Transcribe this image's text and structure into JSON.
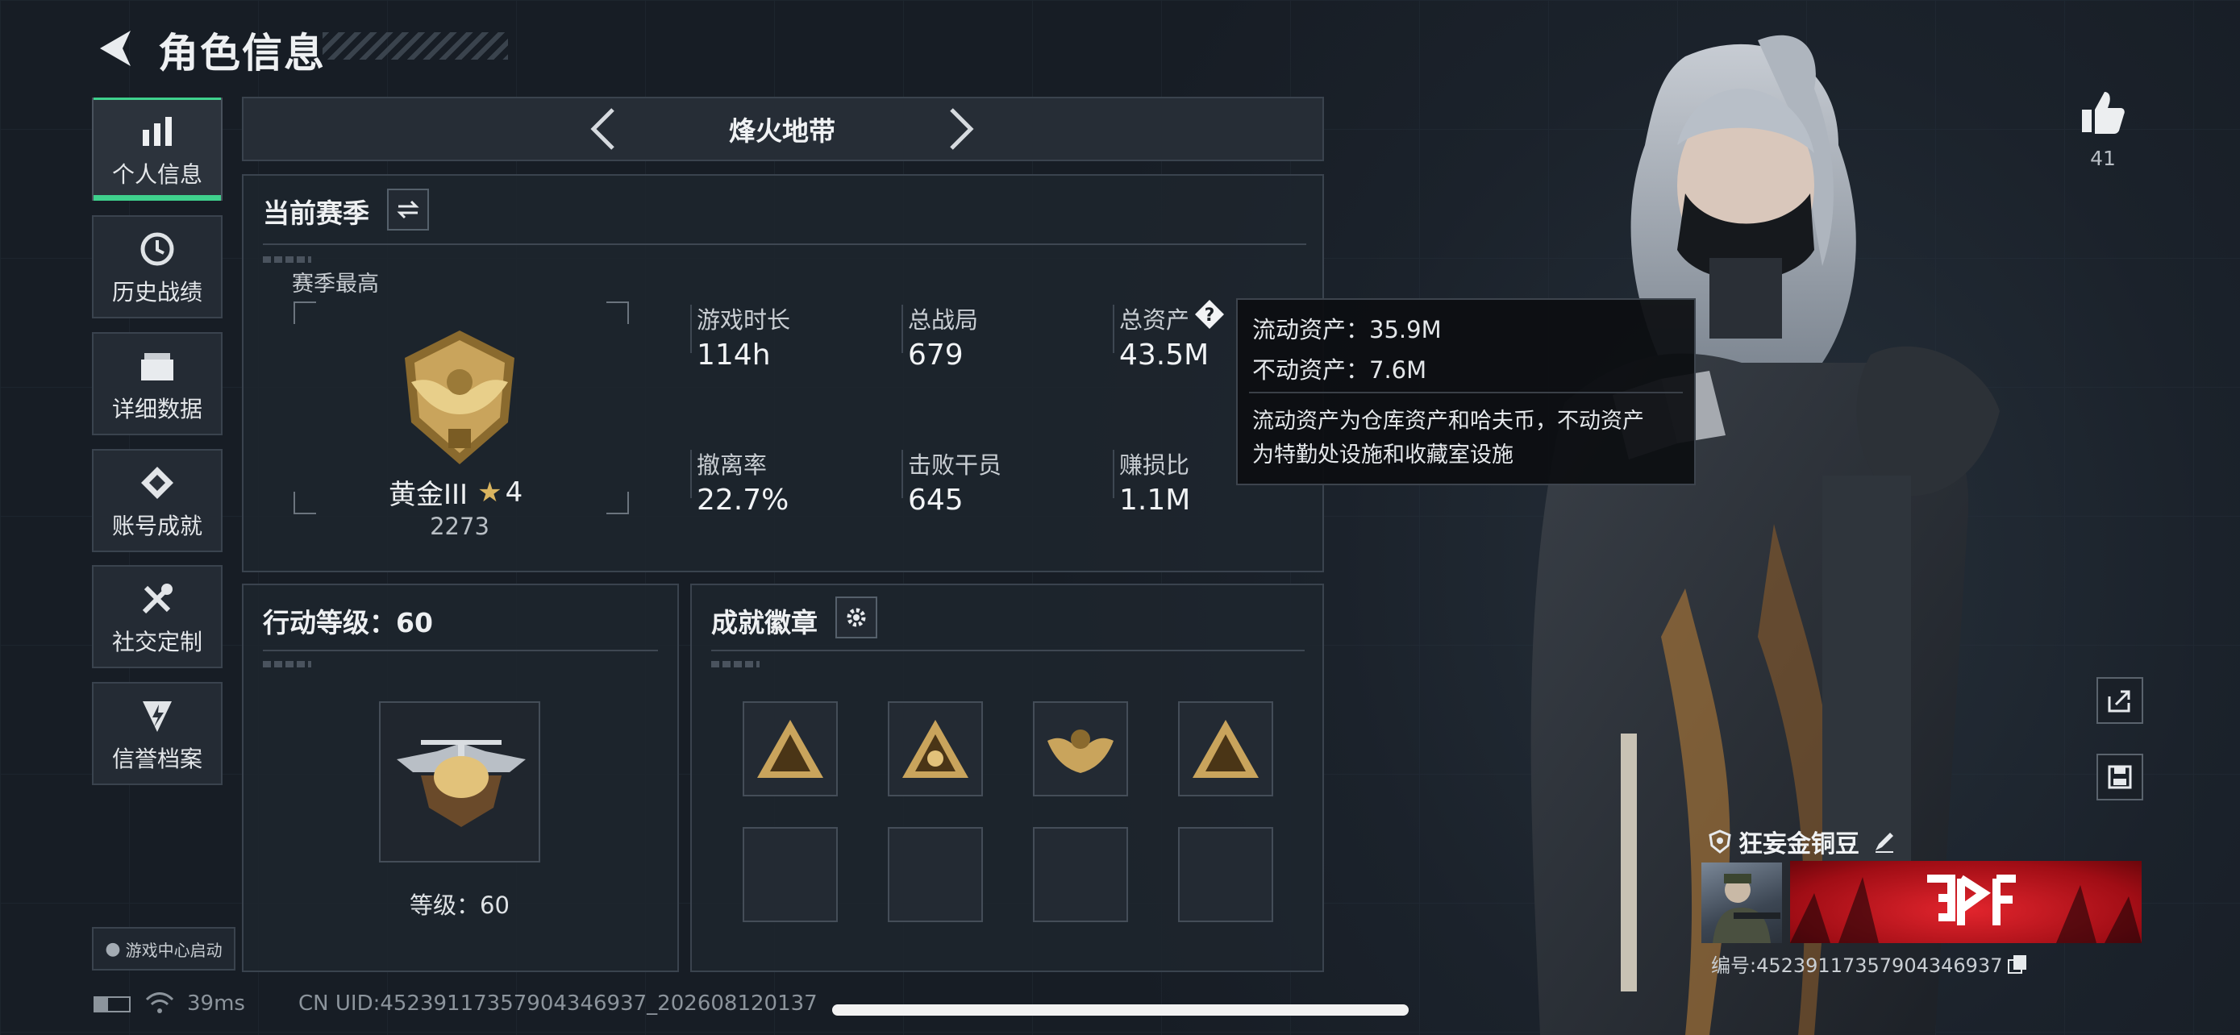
{
  "header": {
    "title": "角色信息"
  },
  "sidebar": {
    "items": [
      {
        "label": "个人信息",
        "icon": "bar-chart-icon",
        "active": true
      },
      {
        "label": "历史战绩",
        "icon": "history-clock-icon"
      },
      {
        "label": "详细数据",
        "icon": "folder-stack-icon"
      },
      {
        "label": "账号成就",
        "icon": "achievement-medal-icon"
      },
      {
        "label": "社交定制",
        "icon": "tools-wrench-icon"
      },
      {
        "label": "信誉档案",
        "icon": "shield-lightning-icon"
      }
    ],
    "game_center": "游戏中心启动"
  },
  "mode_switcher": {
    "label": "烽火地带"
  },
  "season": {
    "title": "当前赛季",
    "best_label": "赛季最高",
    "rank_name": "黄金III",
    "rank_stars": "4",
    "rank_points": "2273",
    "stats": [
      {
        "label": "游戏时长",
        "value": "114h"
      },
      {
        "label": "总战局",
        "value": "679"
      },
      {
        "label": "总资产",
        "value": "43.5M"
      },
      {
        "label": "撤离率",
        "value": "22.7%"
      },
      {
        "label": "击败干员",
        "value": "645"
      },
      {
        "label": "赚损比",
        "value": "1.1M"
      }
    ]
  },
  "tooltip": {
    "liquid": "流动资产：35.9M",
    "fixed": "不动资产：7.6M",
    "desc_line1": "流动资产为仓库资产和哈夫币，不动资产",
    "desc_line2": "为特勤处设施和收藏室设施"
  },
  "action_level": {
    "title": "行动等级：60",
    "level_text": "等级：60"
  },
  "achievements": {
    "title": "成就徽章"
  },
  "likes": {
    "count": "41"
  },
  "player": {
    "name": "狂妄金铜豆",
    "id": "编号:4523911735790434​6937"
  },
  "status_bar": {
    "ping": "39ms",
    "uid": "CN UID:4523911735790434​6937_202608120137"
  },
  "colors": {
    "accent": "#3fd18d",
    "gold": "#c9a45c",
    "banner_red": "#c8141e"
  }
}
